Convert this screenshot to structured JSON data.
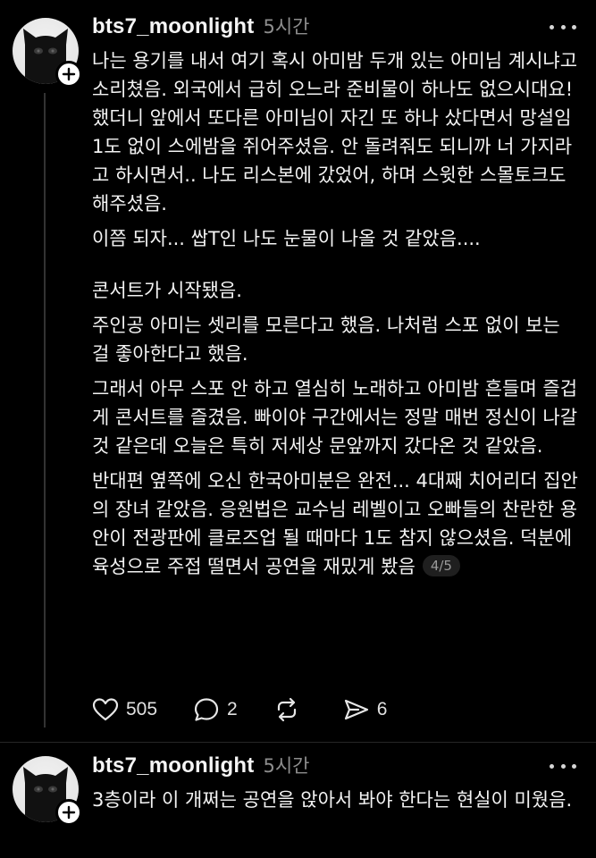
{
  "posts": [
    {
      "username": "bts7_moonlight",
      "time": "5시간",
      "paragraphs": [
        "나는 용기를 내서 여기 혹시 아미밤 두개 있는 아미님 계시냐고 소리쳤음. 외국에서 급히 오느라 준비물이 하나도 없으시대요! 했더니 앞에서 또다른 아미님이 자긴 또 하나 샀다면서 망설임 1도 없이 스에밤을 쥐어주셨음. 안 돌려줘도 되니까 너 가지라고 하시면서.. 나도 리스본에 갔었어, 하며 스윗한 스몰토크도 해주셨음.",
        "이쯤 되자... 쌉T인 나도 눈물이 나올 것 같았음....",
        "콘서트가 시작됐음.",
        "주인공 아미는 셋리를 모른다고 했음. 나처럼 스포 없이 보는 걸 좋아한다고 했음.",
        "그래서 아무 스포 안 하고 열심히 노래하고 아미밤 흔들며 즐겁게 콘서트를 즐겼음. 빠이야 구간에서는 정말 매번 정신이 나갈 것 같은데 오늘은 특히 저세상 문앞까지 갔다온 것 같았음.",
        "반대편 옆쪽에 오신 한국아미분은 완전... 4대째 치어리더 집안의 장녀 같았음. 응원법은 교수님 레벨이고 오빠들의 찬란한 용안이 전광판에 클로즈업 될 때마다 1도 참지 않으셨음. 덕분에 육성으로 주접 떨면서 공연을 재밌게 봤음"
      ],
      "page_indicator": "4/5",
      "likes": "505",
      "comments": "2",
      "reposts": "",
      "shares": "6"
    },
    {
      "username": "bts7_moonlight",
      "time": "5시간",
      "paragraphs": [
        "3층이라 이 개쩌는 공연을 앉아서 봐야 한다는 현실이 미웠음."
      ]
    }
  ]
}
